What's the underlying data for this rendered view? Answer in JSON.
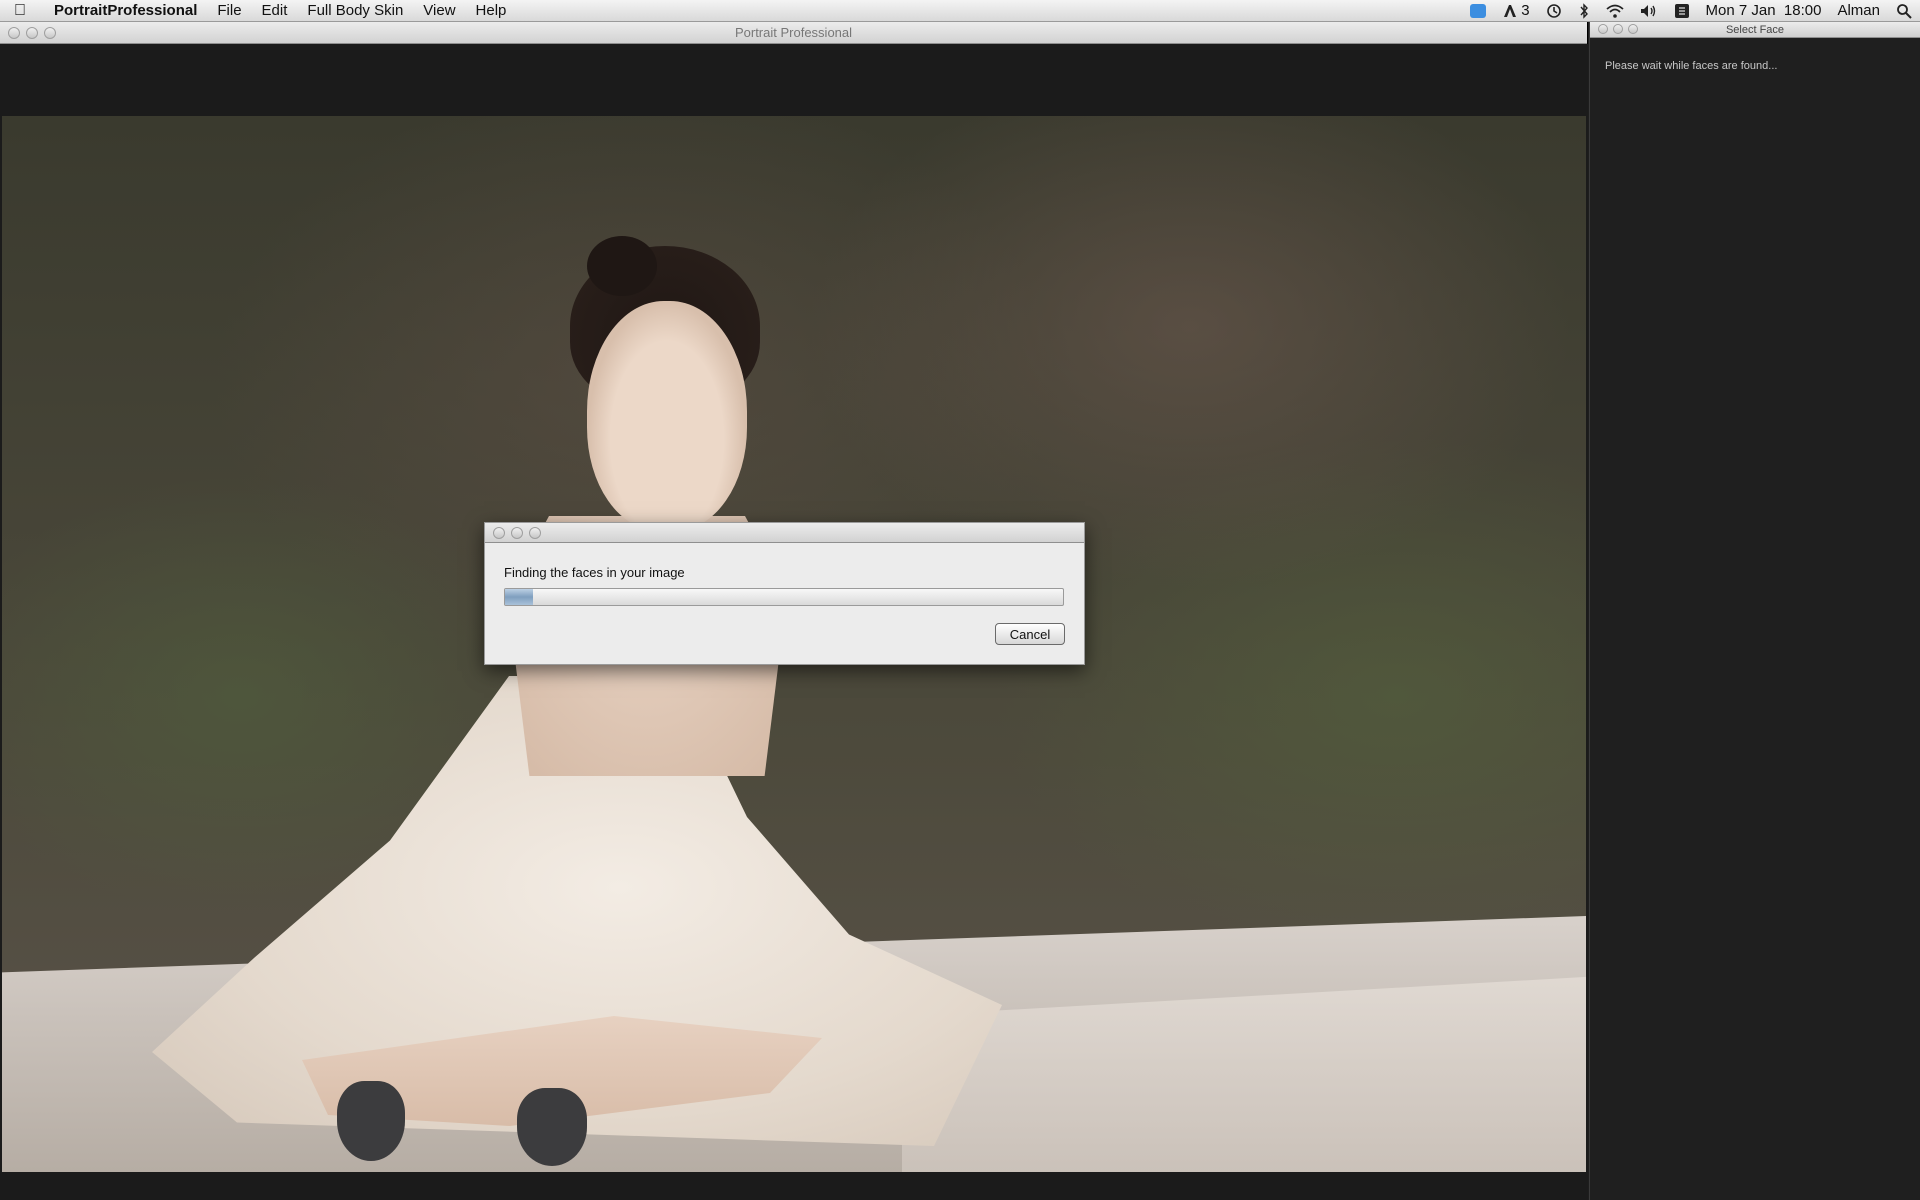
{
  "menubar": {
    "app_name": "PortraitProfessional",
    "menus": [
      "File",
      "Edit",
      "Full Body Skin",
      "View",
      "Help"
    ],
    "status": {
      "adobe_count": "3",
      "datetime": "Mon 7 Jan  18:00",
      "user": "Alman"
    },
    "icons": [
      "apple-icon",
      "dropbox-icon",
      "adobe-icon",
      "time-machine-icon",
      "bluetooth-icon",
      "wifi-icon",
      "volume-icon",
      "keyboard-icon",
      "spotlight-icon"
    ]
  },
  "main_window": {
    "title": "Portrait Professional"
  },
  "dialog": {
    "message": "Finding the faces in your image",
    "progress": 0.05,
    "cancel_label": "Cancel"
  },
  "select_face_panel": {
    "title": "Select Face",
    "status": "Please wait while faces are found..."
  },
  "colors": {
    "app_background": "#1e1e1e",
    "progress_fill": "#7f9fbf",
    "panel_text": "#c8c8c8"
  }
}
